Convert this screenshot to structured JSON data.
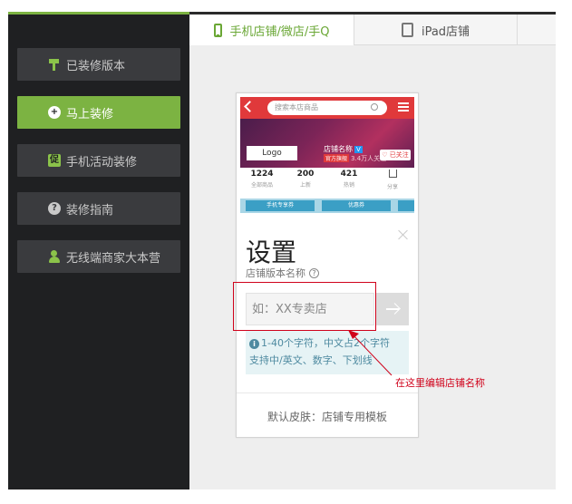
{
  "sidebar": {
    "items": [
      {
        "label": "已装修版本",
        "icon": "paint-roller-icon",
        "active": false
      },
      {
        "label": "马上装修",
        "icon": "plus-circle-icon",
        "active": true
      },
      {
        "label": "手机活动装修",
        "icon": "promo-badge-icon",
        "icon_text": "促",
        "active": false
      },
      {
        "label": "装修指南",
        "icon": "help-circle-icon",
        "icon_text": "?",
        "active": false
      },
      {
        "label": "无线端商家大本营",
        "icon": "merchant-user-icon",
        "active": false
      }
    ]
  },
  "tabs": [
    {
      "label": "手机店铺/微店/手Q",
      "icon": "mobile-phone-icon",
      "active": true
    },
    {
      "label": "iPad店铺",
      "icon": "tablet-icon",
      "active": false
    }
  ],
  "preview": {
    "search_placeholder": "搜索本店商品",
    "logo": "Logo",
    "shop_name": "店铺名称",
    "shop_badge": "V",
    "shop_tag": "官方旗舰",
    "followers": "3.4万人关注",
    "follow": "♡ 已关注",
    "stats": [
      {
        "value": "1224",
        "label": "全部商品"
      },
      {
        "value": "200",
        "label": "上新"
      },
      {
        "value": "421",
        "label": "热销"
      },
      {
        "value": "",
        "label": "分享"
      }
    ],
    "coupons": [
      "手机专享券",
      "优惠券"
    ]
  },
  "modal": {
    "title": "设置",
    "subtitle": "店铺版本名称",
    "input_placeholder": "如：XX专卖店",
    "hint_line1": "1-40个字符，中文占2个字符",
    "hint_line2": "支持中/英文、数字、下划线",
    "skin": "默认皮肤：店铺专用模板"
  },
  "annotation": "在这里编辑店铺名称",
  "colors": {
    "accent_green": "#7cb342",
    "sidebar_bg": "#1f2022",
    "shop_red": "#e0393b",
    "annotation_red": "#d0021b"
  }
}
